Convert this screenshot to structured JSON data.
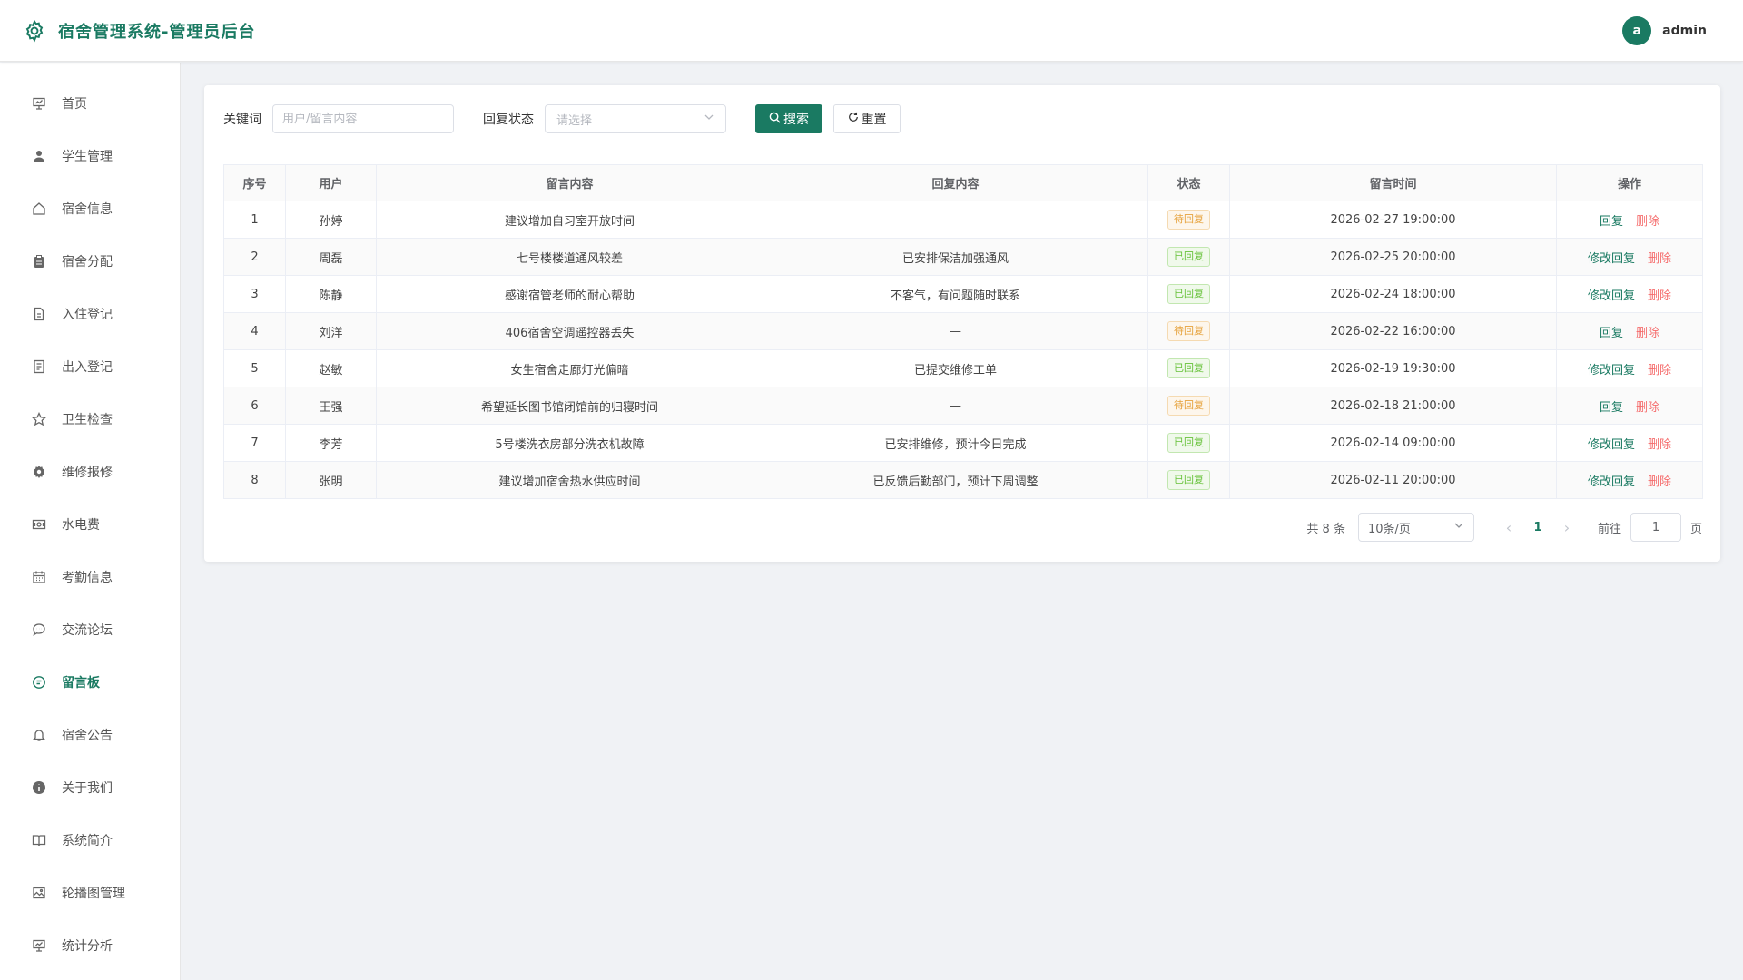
{
  "app": {
    "title": "宿舍管理系统-管理员后台",
    "user": {
      "initial": "a",
      "name": "admin"
    },
    "accent": "#1a7a62"
  },
  "sidebar": {
    "items": [
      {
        "label": "首页",
        "icon": "presentation-icon"
      },
      {
        "label": "学生管理",
        "icon": "user-icon"
      },
      {
        "label": "宿舍信息",
        "icon": "home-icon"
      },
      {
        "label": "宿舍分配",
        "icon": "clipboard-icon"
      },
      {
        "label": "入住登记",
        "icon": "document-icon"
      },
      {
        "label": "出入登记",
        "icon": "document-list-icon"
      },
      {
        "label": "卫生检查",
        "icon": "star-icon"
      },
      {
        "label": "维修报修",
        "icon": "gear-icon"
      },
      {
        "label": "水电费",
        "icon": "money-icon"
      },
      {
        "label": "考勤信息",
        "icon": "calendar-icon"
      },
      {
        "label": "交流论坛",
        "icon": "chat-icon"
      },
      {
        "label": "留言板",
        "icon": "message-icon"
      },
      {
        "label": "宿舍公告",
        "icon": "bell-icon"
      },
      {
        "label": "关于我们",
        "icon": "info-icon"
      },
      {
        "label": "系统简介",
        "icon": "book-icon"
      },
      {
        "label": "轮播图管理",
        "icon": "picture-icon"
      },
      {
        "label": "统计分析",
        "icon": "chart-board-icon"
      }
    ],
    "active_index": 11
  },
  "filters": {
    "keyword_label": "关键词",
    "keyword_placeholder": "用户/留言内容",
    "keyword_value": "",
    "status_label": "回复状态",
    "status_placeholder": "请选择",
    "search_button": "搜索",
    "reset_button": "重置"
  },
  "table": {
    "columns": [
      "序号",
      "用户",
      "留言内容",
      "回复内容",
      "状态",
      "留言时间",
      "操作"
    ],
    "rows": [
      {
        "no": "1",
        "user": "孙婷",
        "content": "建议增加自习室开放时间",
        "reply": "—",
        "status": "待回复",
        "status_type": "pending",
        "time": "2026-02-27 19:00:00",
        "op_reply": "回复",
        "op_delete": "删除"
      },
      {
        "no": "2",
        "user": "周磊",
        "content": "七号楼楼道通风较差",
        "reply": "已安排保洁加强通风",
        "status": "已回复",
        "status_type": "replied",
        "time": "2026-02-25 20:00:00",
        "op_reply": "修改回复",
        "op_delete": "删除"
      },
      {
        "no": "3",
        "user": "陈静",
        "content": "感谢宿管老师的耐心帮助",
        "reply": "不客气，有问题随时联系",
        "status": "已回复",
        "status_type": "replied",
        "time": "2026-02-24 18:00:00",
        "op_reply": "修改回复",
        "op_delete": "删除"
      },
      {
        "no": "4",
        "user": "刘洋",
        "content": "406宿舍空调遥控器丢失",
        "reply": "—",
        "status": "待回复",
        "status_type": "pending",
        "time": "2026-02-22 16:00:00",
        "op_reply": "回复",
        "op_delete": "删除"
      },
      {
        "no": "5",
        "user": "赵敏",
        "content": "女生宿舍走廊灯光偏暗",
        "reply": "已提交维修工单",
        "status": "已回复",
        "status_type": "replied",
        "time": "2026-02-19 19:30:00",
        "op_reply": "修改回复",
        "op_delete": "删除"
      },
      {
        "no": "6",
        "user": "王强",
        "content": "希望延长图书馆闭馆前的归寝时间",
        "reply": "—",
        "status": "待回复",
        "status_type": "pending",
        "time": "2026-02-18 21:00:00",
        "op_reply": "回复",
        "op_delete": "删除"
      },
      {
        "no": "7",
        "user": "李芳",
        "content": "5号楼洗衣房部分洗衣机故障",
        "reply": "已安排维修，预计今日完成",
        "status": "已回复",
        "status_type": "replied",
        "time": "2026-02-14 09:00:00",
        "op_reply": "修改回复",
        "op_delete": "删除"
      },
      {
        "no": "8",
        "user": "张明",
        "content": "建议增加宿舍热水供应时间",
        "reply": "已反馈后勤部门，预计下周调整",
        "status": "已回复",
        "status_type": "replied",
        "time": "2026-02-11 20:00:00",
        "op_reply": "修改回复",
        "op_delete": "删除"
      }
    ]
  },
  "pagination": {
    "total_text": "共 8 条",
    "page_size": "10条/页",
    "current_page": "1",
    "goto_label": "前往",
    "goto_value": "1",
    "page_unit": "页"
  }
}
